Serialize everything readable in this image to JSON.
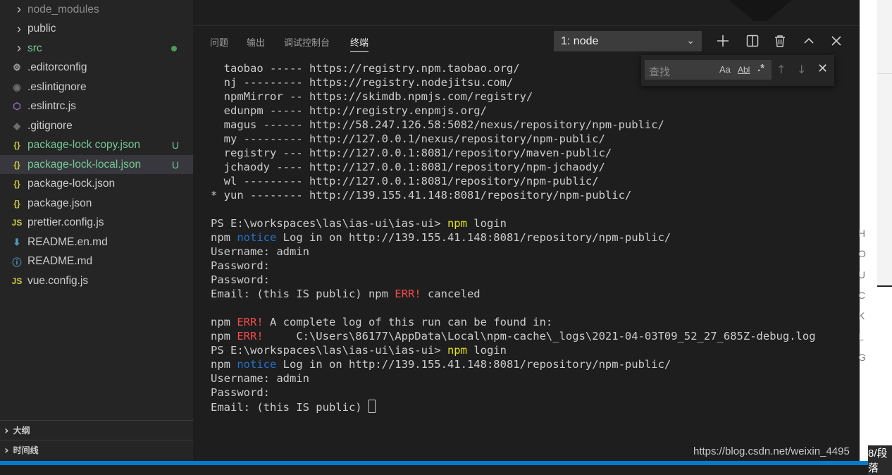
{
  "explorer": {
    "items": [
      {
        "label": "node_modules",
        "kind": "folder",
        "icon": "chevron-right-icon",
        "style": "dim"
      },
      {
        "label": "public",
        "kind": "folder",
        "icon": "chevron-right-icon",
        "style": ""
      },
      {
        "label": "src",
        "kind": "folder",
        "icon": "chevron-right-icon",
        "style": "green",
        "status": "modified-dot"
      },
      {
        "label": ".editorconfig",
        "icon": "gear-icon",
        "style": ""
      },
      {
        "label": ".eslintignore",
        "icon": "eslint-ignore-icon",
        "style": ""
      },
      {
        "label": ".eslintrc.js",
        "icon": "eslint-icon",
        "style": ""
      },
      {
        "label": ".gitignore",
        "icon": "git-icon",
        "style": ""
      },
      {
        "label": "package-lock copy.json",
        "icon": "json-icon",
        "style": "green",
        "badge": "U"
      },
      {
        "label": "package-lock-local.json",
        "icon": "json-icon",
        "style": "green",
        "badge": "U",
        "selected": true
      },
      {
        "label": "package-lock.json",
        "icon": "json-icon",
        "style": ""
      },
      {
        "label": "package.json",
        "icon": "json-icon",
        "style": ""
      },
      {
        "label": "prettier.config.js",
        "icon": "js-icon",
        "style": ""
      },
      {
        "label": "README.en.md",
        "icon": "download-arrow-icon",
        "style": ""
      },
      {
        "label": "README.md",
        "icon": "info-icon",
        "style": ""
      },
      {
        "label": "vue.config.js",
        "icon": "js-icon",
        "style": ""
      }
    ],
    "sections": {
      "outline": "大纲",
      "timeline": "时间线"
    }
  },
  "panel": {
    "tabs": [
      "问题",
      "输出",
      "调试控制台",
      "终端"
    ],
    "active_tab": "终端",
    "terminal_select": "1: node"
  },
  "find": {
    "placeholder": "查找",
    "match_case": "Aa",
    "whole_word": "Abl",
    "regex": ".*"
  },
  "terminal": {
    "lines": [
      [
        {
          "t": "  taobao ----- https://registry.npm.taobao.org/"
        }
      ],
      [
        {
          "t": "  nj --------- https://registry.nodejitsu.com/"
        }
      ],
      [
        {
          "t": "  npmMirror -- https://skimdb.npmjs.com/registry/"
        }
      ],
      [
        {
          "t": "  edunpm ----- http://registry.enpmjs.org/"
        }
      ],
      [
        {
          "t": "  magus ------ http://58.247.126.58:5082/nexus/repository/npm-public/"
        }
      ],
      [
        {
          "t": "  my --------- http://127.0.0.1/nexus/repository/npm-public/"
        }
      ],
      [
        {
          "t": "  registry --- http://127.0.0.1:8081/repository/maven-public/"
        }
      ],
      [
        {
          "t": "  jchaody ---- http://127.0.0.1:8081/repository/npm-jchaody/"
        }
      ],
      [
        {
          "t": "  wl --------- http://127.0.0.1:8081/repository/npm-public/"
        }
      ],
      [
        {
          "t": "* yun -------- http://139.155.41.148:8081/repository/npm-public/"
        }
      ],
      [
        {
          "t": ""
        }
      ],
      [
        {
          "t": "PS E:\\workspaces\\las\\ias-ui\\ias-ui> "
        },
        {
          "t": "npm",
          "c": "y"
        },
        {
          "t": " login"
        }
      ],
      [
        {
          "t": "npm "
        },
        {
          "t": "notice",
          "c": "b"
        },
        {
          "t": " Log in on http://139.155.41.148:8081/repository/npm-public/"
        }
      ],
      [
        {
          "t": "Username: admin"
        }
      ],
      [
        {
          "t": "Password:"
        }
      ],
      [
        {
          "t": "Password:"
        }
      ],
      [
        {
          "t": "Email: (this IS public) npm "
        },
        {
          "t": "ERR!",
          "c": "r"
        },
        {
          "t": " canceled"
        }
      ],
      [
        {
          "t": ""
        }
      ],
      [
        {
          "t": "npm "
        },
        {
          "t": "ERR!",
          "c": "r"
        },
        {
          "t": " A complete log of this run can be found in:"
        }
      ],
      [
        {
          "t": "npm "
        },
        {
          "t": "ERR!",
          "c": "r"
        },
        {
          "t": "     C:\\Users\\86177\\AppData\\Local\\npm-cache\\_logs\\2021-04-03T09_52_27_685Z-debug.log"
        }
      ],
      [
        {
          "t": "PS E:\\workspaces\\las\\ias-ui\\ias-ui> "
        },
        {
          "t": "npm",
          "c": "y"
        },
        {
          "t": " login"
        }
      ],
      [
        {
          "t": "npm "
        },
        {
          "t": "notice",
          "c": "b"
        },
        {
          "t": " Log in on http://139.155.41.148:8081/repository/npm-public/"
        }
      ],
      [
        {
          "t": "Username: admin"
        }
      ],
      [
        {
          "t": "Password:"
        }
      ],
      [
        {
          "t": "Email: (this IS public) "
        },
        {
          "cursor": true
        }
      ]
    ]
  },
  "right_letters": [
    "H",
    "O",
    "U",
    "C",
    "K",
    "L",
    "G"
  ],
  "watermark": "https://blog.csdn.net/weixin_4495",
  "watermark_tail": "8/段落"
}
